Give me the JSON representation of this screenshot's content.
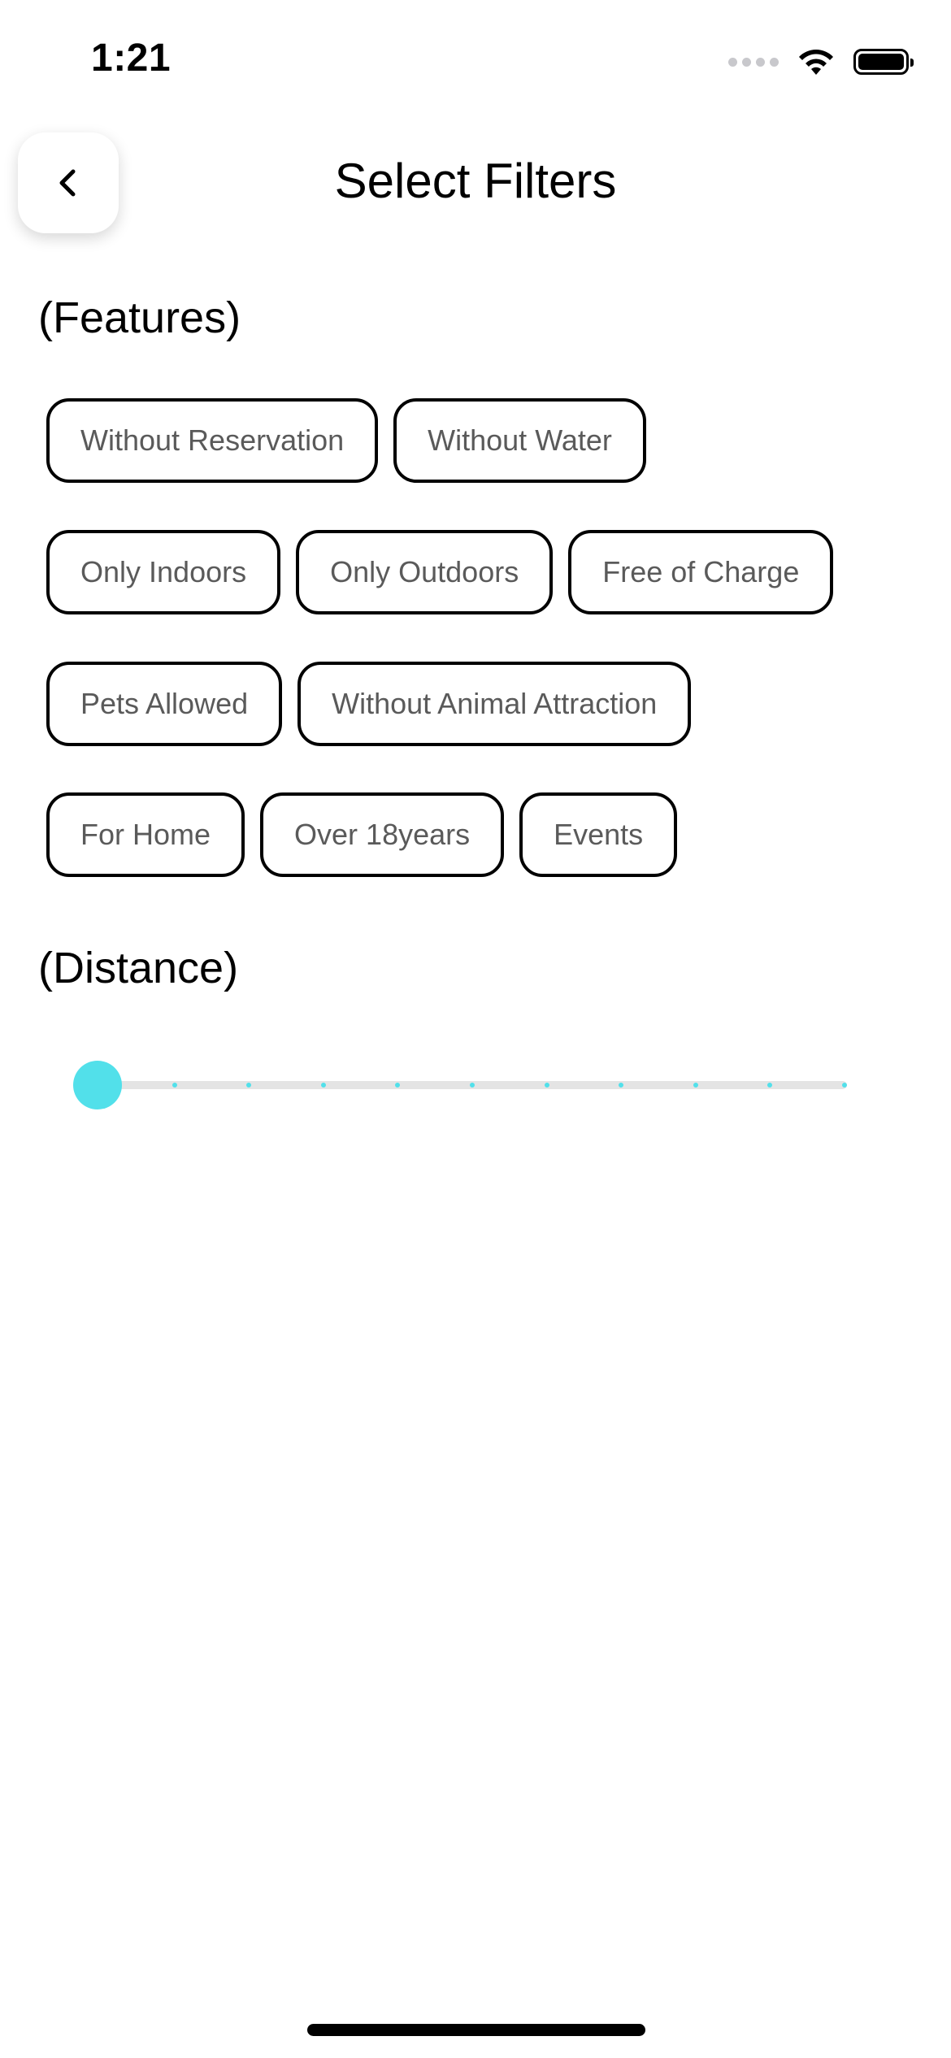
{
  "status_bar": {
    "time": "1:21"
  },
  "header": {
    "title": "Select Filters",
    "back_icon": "chevron-left-icon"
  },
  "features": {
    "title": "(Features)",
    "rows": [
      [
        "Without Reservation",
        "Without Water"
      ],
      [
        "Only Indoors",
        "Only Outdoors",
        "Free of Charge"
      ],
      [
        "Pets Allowed",
        "Without Animal Attraction"
      ],
      [
        "For Home",
        "Over 18years",
        "Events"
      ]
    ]
  },
  "distance": {
    "title": "(Distance)",
    "slider": {
      "value_fraction": 0,
      "steps": 10,
      "accent_color": "#52e0ea",
      "track_color": "#e4e4e4"
    }
  }
}
